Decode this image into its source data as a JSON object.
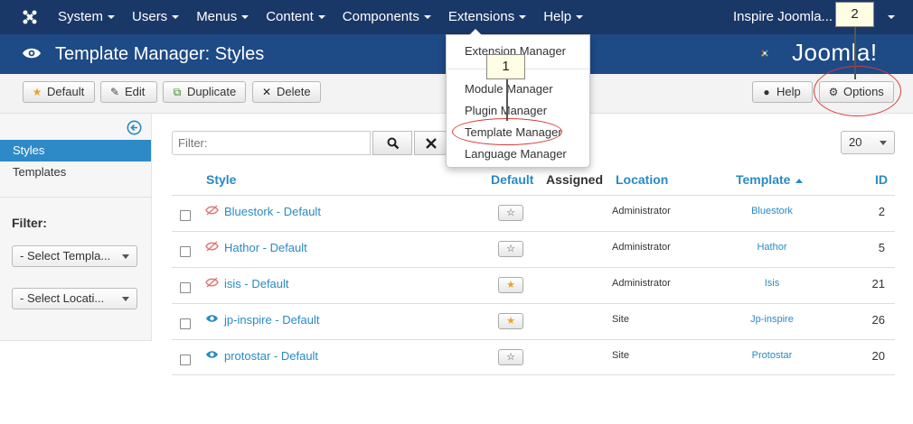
{
  "topnav": {
    "logo_icon": "joomla-logo-icon",
    "menu": [
      "System",
      "Users",
      "Menus",
      "Content",
      "Components",
      "Extensions",
      "Help"
    ],
    "user": "Inspire Joomla..."
  },
  "titlebar": {
    "icon": "eye-icon",
    "title": "Template Manager: Styles",
    "brand": "Joomla!"
  },
  "toolbar": {
    "default": "Default",
    "edit": "Edit",
    "duplicate": "Duplicate",
    "delete": "Delete",
    "help": "Help",
    "options": "Options"
  },
  "sidebar": {
    "items": [
      {
        "label": "Styles",
        "active": true
      },
      {
        "label": "Templates",
        "active": false
      }
    ],
    "filter_label": "Filter:",
    "select_template": "- Select Templa...",
    "select_location": "- Select Locati..."
  },
  "search": {
    "placeholder": "Filter:",
    "limit": "20"
  },
  "table": {
    "headers": {
      "style": "Style",
      "default": "Default",
      "assigned": "Assigned",
      "location": "Location",
      "template": "Template",
      "id": "ID"
    },
    "rows": [
      {
        "style": "Bluestork - Default",
        "location": "Administrator",
        "template": "Bluestork",
        "id": "2",
        "home": false,
        "visible": false
      },
      {
        "style": "Hathor - Default",
        "location": "Administrator",
        "template": "Hathor",
        "id": "5",
        "home": false,
        "visible": false
      },
      {
        "style": "isis - Default",
        "location": "Administrator",
        "template": "Isis",
        "id": "21",
        "home": true,
        "visible": false
      },
      {
        "style": "jp-inspire - Default",
        "location": "Site",
        "template": "Jp-inspire",
        "id": "26",
        "home": true,
        "visible": true
      },
      {
        "style": "protostar - Default",
        "location": "Site",
        "template": "Protostar",
        "id": "20",
        "home": false,
        "visible": true
      }
    ]
  },
  "dropdown": {
    "items": [
      "Extension Manager",
      "Module Manager",
      "Plugin Manager",
      "Template Manager",
      "Language Manager"
    ]
  },
  "annotations": {
    "callout_1": "1",
    "callout_2": "2"
  },
  "colors": {
    "nav_bg": "#1a3867",
    "title_bg": "#1e4a85",
    "link": "#2a8ac3",
    "active": "#2d8ac7",
    "annotation_ring": "#d83a3a"
  }
}
